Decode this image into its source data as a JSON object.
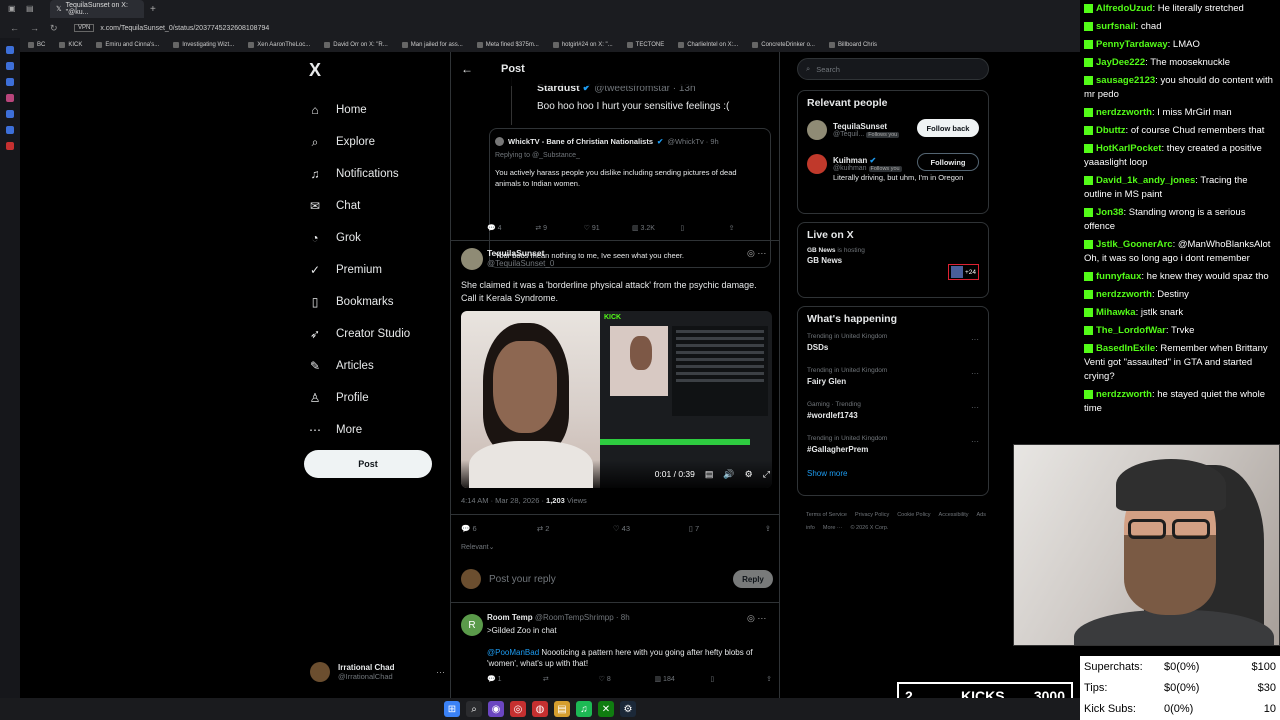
{
  "browser": {
    "tab_title": "TequilaSunset on X: \"@ku...",
    "url": "x.com/TequilaSunset_0/status/2037745232608108794",
    "vpn": "VPN",
    "bookmarks": [
      "BC",
      "KICK",
      "Emiru and Cinna's...",
      "Investigating Wizt...",
      "Xen AaronTheLoc...",
      "David Orr on X: \"R...",
      "Man jailed for ass...",
      "Meta fined $375m...",
      "hotgirl#24 on X: \"...",
      "TECTONE",
      "CharlieIntel on X:...",
      "ConcreteDrinker o...",
      "Billboard Chris"
    ]
  },
  "sidebar": {
    "logo": "X",
    "items": [
      {
        "label": "Home",
        "icon": "⌂"
      },
      {
        "label": "Explore",
        "icon": "⌕"
      },
      {
        "label": "Notifications",
        "icon": "♫"
      },
      {
        "label": "Chat",
        "icon": "✉"
      },
      {
        "label": "Grok",
        "icon": "◔"
      },
      {
        "label": "Premium",
        "icon": "✓"
      },
      {
        "label": "Bookmarks",
        "icon": "▯"
      },
      {
        "label": "Creator Studio",
        "icon": "➶"
      },
      {
        "label": "Articles",
        "icon": "✎"
      },
      {
        "label": "Profile",
        "icon": "♙"
      },
      {
        "label": "More",
        "icon": "⋯"
      }
    ],
    "post_button": "Post",
    "account": {
      "name": "Irrational Chad",
      "handle": "@IrrationalChad"
    }
  },
  "main": {
    "header_title": "Post",
    "quote1": {
      "name": "Stardust",
      "handle": "@tweetsfromstar · 13h",
      "text": "Boo hoo hoo I hurt your sensitive feelings :("
    },
    "quote2": {
      "name": "WhickTV - Bane of Christian Nationalists",
      "handle": "@WhickTv · 9h",
      "replying": "Replying to @_Substance_",
      "text1": "You actively harass people you dislike including sending pictures of dead animals to Indian women.",
      "text2": "Your boos mean nothing to me, Ive seen what you cheer."
    },
    "quote_actions": {
      "replies": "4",
      "reposts": "9",
      "likes": "91",
      "views": "3.2K"
    },
    "post": {
      "name": "TequilaSunset",
      "handle": "@TequilaSunset_0",
      "text": "She claimed it was a 'borderline physical attack' from the psychic damage. Call it Kerala Syndrome.",
      "media_kick_label": "KICK",
      "video_time": "0:01 / 0:39",
      "timestamp": "4:14 AM · Mar 28, 2026 · ",
      "views_count": "1,203",
      "views_label": " Views",
      "replies": "6",
      "reposts": "2",
      "likes": "43",
      "bookmarks": "7",
      "sort_label": "Relevant"
    },
    "reply_placeholder": "Post your reply",
    "reply_button": "Reply",
    "comment": {
      "avatar_letter": "R",
      "name": "Room Temp",
      "handle": "@RoomTempShrimpp · 8h",
      "text1": ">Gilded Zoo in chat",
      "mention": "@PooManBad",
      "text2": " Noooticing a pattern here with you going after hefty blobs of 'women', what's up with that!",
      "replies": "1",
      "likes": "8",
      "views": "184"
    }
  },
  "right": {
    "search_placeholder": "Search",
    "relevant_title": "Relevant people",
    "people": [
      {
        "name": "TequilaSunset",
        "handle": "@Tequil...",
        "badge": "Follows you",
        "button": "Follow back",
        "color": "#8f8b75"
      },
      {
        "name": "Kuihman",
        "handle": "@kuihman",
        "badge": "Follows you",
        "button": "Following",
        "bio": "Literally driving, but uhm, I'm in Oregon",
        "color": "#c0392b"
      }
    ],
    "live_title": "Live on X",
    "live_host": "GB News",
    "live_host_suffix": " is hosting",
    "live_show": "GB News",
    "live_count": "+24",
    "happening_title": "What's happening",
    "trends": [
      {
        "sub": "Trending in United Kingdom",
        "name": "DSDs"
      },
      {
        "sub": "Trending in United Kingdom",
        "name": "Fairy Glen"
      },
      {
        "sub": "Gaming · Trending",
        "name": "#wordlef1743"
      },
      {
        "sub": "Trending in United Kingdom",
        "name": "#GallagherPrem"
      }
    ],
    "show_more": "Show more",
    "footer": [
      "Terms of Service",
      "Privacy Policy",
      "Cookie Policy",
      "Accessibility",
      "Ads info",
      "More ···",
      "© 2026 X Corp."
    ]
  },
  "chat": [
    {
      "user": "AlfredoUzud",
      "text": "He literally stretched",
      "color": "#53fc18"
    },
    {
      "user": "surfsnail",
      "text": "chad",
      "color": "#53fc18"
    },
    {
      "user": "PennyTardaway",
      "text": "LMAO",
      "color": "#53fc18"
    },
    {
      "user": "JayDee222",
      "text": "The mooseknuckle",
      "color": "#53fc18"
    },
    {
      "user": "sausage2123",
      "text": "you should do content with mr pedo",
      "color": "#53fc18"
    },
    {
      "user": "nerdzzworth",
      "text": "I miss MrGirl man",
      "color": "#53fc18"
    },
    {
      "user": "Dbuttz",
      "text": "of course Chud remembers that",
      "color": "#53fc18"
    },
    {
      "user": "HotKarlPocket",
      "text": "they created a positive yaaaslight loop",
      "color": "#53fc18"
    },
    {
      "user": "David_1k_andy_jones",
      "text": "Tracing the outline in MS paint",
      "color": "#53fc18"
    },
    {
      "user": "Jon38",
      "text": "Standing wrong is a serious offence",
      "color": "#53fc18"
    },
    {
      "user": "Jstlk_GoonerArc",
      "text": "@ManWhoBlanksAlot Oh, it was so long ago i dont remember",
      "color": "#53fc18"
    },
    {
      "user": "funnyfaux",
      "text": "he knew they would spaz tho",
      "color": "#53fc18"
    },
    {
      "user": "nerdzzworth",
      "text": "Destiny",
      "color": "#53fc18"
    },
    {
      "user": "Mihawka",
      "text": "jstlk snark",
      "color": "#53fc18"
    },
    {
      "user": "The_LordofWar",
      "text": "Trvke",
      "color": "#53fc18"
    },
    {
      "user": "BasedInExile",
      "text": "Remember when Brittany Venti got \"assaulted\" in GTA and started crying?",
      "color": "#53fc18"
    },
    {
      "user": "nerdzzworth",
      "text": "he stayed quiet the whole time",
      "color": "#53fc18"
    }
  ],
  "overlay": {
    "kicks_count": "2",
    "kicks_label": "KICKS",
    "kicks_total": "3000",
    "stats": [
      {
        "label": "Superchats:",
        "value": "$0(0%)",
        "goal": "$100"
      },
      {
        "label": "Tips:",
        "value": "$0(0%)",
        "goal": "$30"
      },
      {
        "label": "Kick Subs:",
        "value": "0(0%)",
        "goal": "10"
      }
    ]
  },
  "taskbar": [
    {
      "name": "windows",
      "glyph": "⊞",
      "color": "#3b82f6"
    },
    {
      "name": "search",
      "glyph": "⌕",
      "color": "#2a2b2e"
    },
    {
      "name": "app1",
      "glyph": "◉",
      "color": "#6b46c1"
    },
    {
      "name": "app2",
      "glyph": "◎",
      "color": "#c53030"
    },
    {
      "name": "chrome",
      "glyph": "◍",
      "color": "#c53030"
    },
    {
      "name": "files",
      "glyph": "▤",
      "color": "#d69e2e"
    },
    {
      "name": "spotify",
      "glyph": "♫",
      "color": "#1db954"
    },
    {
      "name": "xbox",
      "glyph": "✕",
      "color": "#107c10"
    },
    {
      "name": "steam",
      "glyph": "⚙",
      "color": "#1b2838"
    }
  ]
}
